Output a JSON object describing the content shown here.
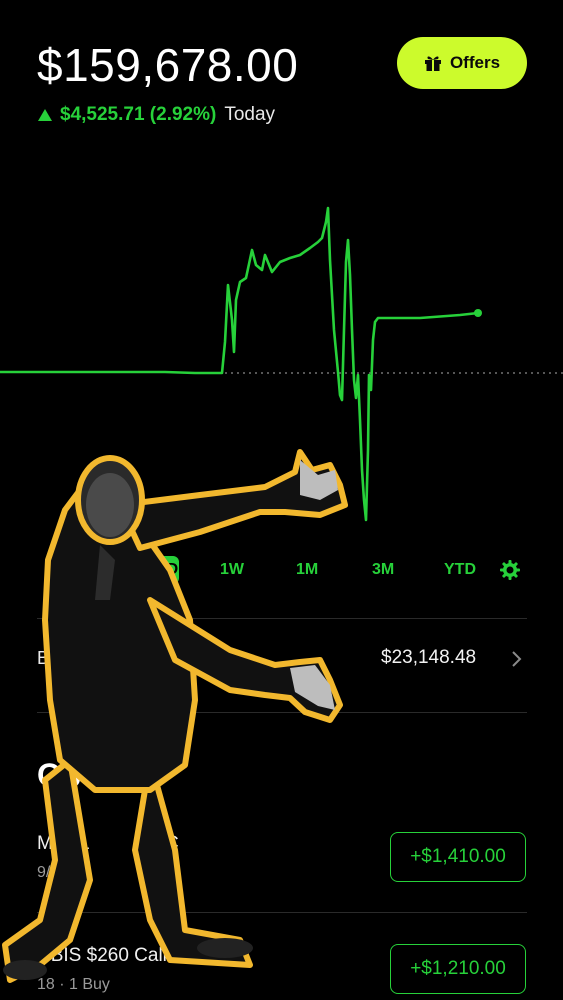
{
  "portfolio": {
    "balance": "$159,678.00",
    "change": "$4,525.71 (2.92%)",
    "period_label": "Today"
  },
  "header": {
    "offers_label": "Offers"
  },
  "chart_data": {
    "type": "line",
    "range": "1D",
    "baseline_visible": true,
    "current_value": "$159,678.00"
  },
  "range_tabs": [
    {
      "label": "1D",
      "active": true
    },
    {
      "label": "1W",
      "active": false
    },
    {
      "label": "1M",
      "active": false
    },
    {
      "label": "3M",
      "active": false
    },
    {
      "label": "YTD",
      "active": false
    }
  ],
  "buying_power": {
    "label": "Bu",
    "value": "$23,148.48"
  },
  "section": {
    "title": "Op"
  },
  "positions": [
    {
      "name": "MRVL",
      "name_tail": "C",
      "sub": "9/1",
      "gain": "+$1,410.00"
    },
    {
      "name": "NBIS $260 Call",
      "sub": "18 · 1 Buy",
      "gain": "+$1,210.00"
    }
  ],
  "colors": {
    "accent_green": "#27d13a",
    "offers_yellow": "#ccfb2c",
    "background": "#000000",
    "overlay_outline": "#f2b82e"
  },
  "icons": {
    "offers": "gift-icon",
    "settings": "gear-icon",
    "row_chevron": "chevron-right-icon",
    "change_arrow": "triangle-up-icon"
  }
}
